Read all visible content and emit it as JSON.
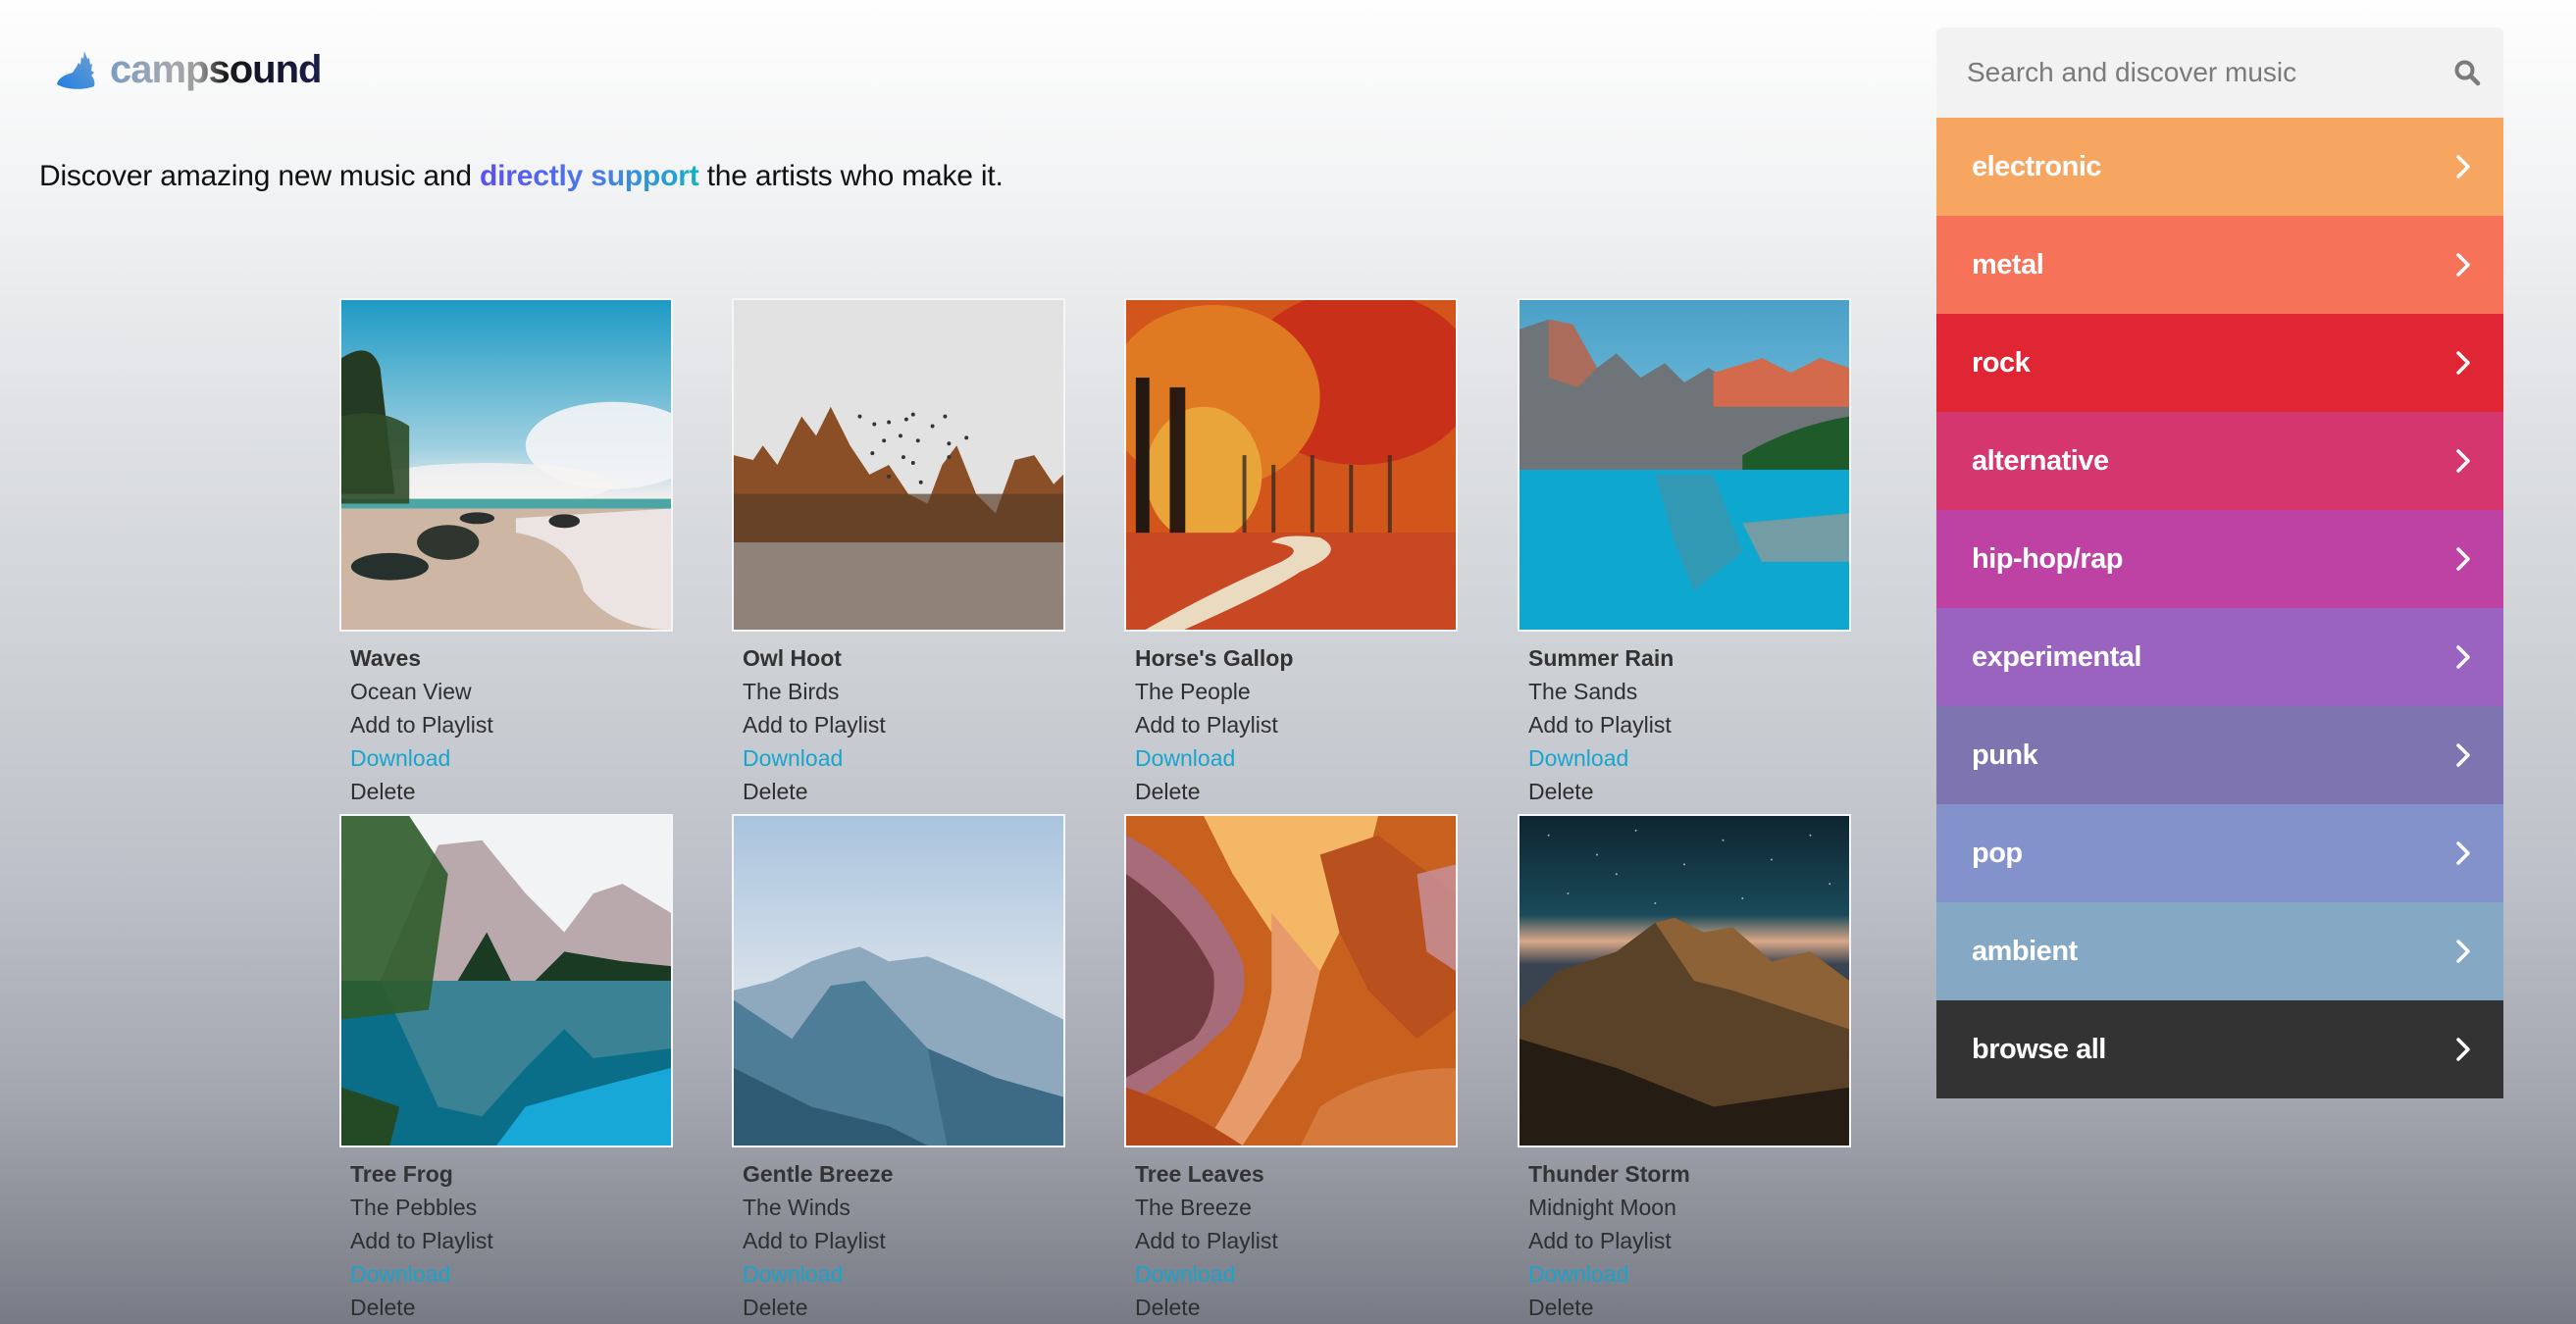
{
  "brand": {
    "name": "campsound",
    "logo_icon": "tree-hill-icon"
  },
  "tagline": {
    "before": "Discover amazing new music and ",
    "highlight": "directly support",
    "after": " the artists who make it."
  },
  "search": {
    "placeholder": "Search and discover music",
    "value": "",
    "icon": "search-icon"
  },
  "genres": [
    {
      "label": "electronic",
      "color": "#f7a662"
    },
    {
      "label": "metal",
      "color": "#f67259"
    },
    {
      "label": "rock",
      "color": "#e02635"
    },
    {
      "label": "alternative",
      "color": "#d4366d"
    },
    {
      "label": "hip-hop/rap",
      "color": "#be42a3"
    },
    {
      "label": "experimental",
      "color": "#9a63c0"
    },
    {
      "label": "punk",
      "color": "#7e74b0"
    },
    {
      "label": "pop",
      "color": "#8492cb"
    },
    {
      "label": "ambient",
      "color": "#85a8c5"
    },
    {
      "label": "browse all",
      "color": "#333333"
    }
  ],
  "actions": {
    "add_to_playlist": "Add to Playlist",
    "download": "Download",
    "delete": "Delete"
  },
  "albums": [
    {
      "title": "Waves",
      "artist": "Ocean View",
      "art": "beach"
    },
    {
      "title": "Owl Hoot",
      "artist": "The Birds",
      "art": "misty-forest"
    },
    {
      "title": "Horse's Gallop",
      "artist": "The People",
      "art": "autumn-path"
    },
    {
      "title": "Summer Rain",
      "artist": "The Sands",
      "art": "mountain-lake"
    },
    {
      "title": "Tree Frog",
      "artist": "The Pebbles",
      "art": "alpine-lake"
    },
    {
      "title": "Gentle Breeze",
      "artist": "The Winds",
      "art": "hazy-mountains"
    },
    {
      "title": "Tree Leaves",
      "artist": "The Breeze",
      "art": "canyon"
    },
    {
      "title": "Thunder Storm",
      "artist": "Midnight Moon",
      "art": "night-peak"
    }
  ]
}
